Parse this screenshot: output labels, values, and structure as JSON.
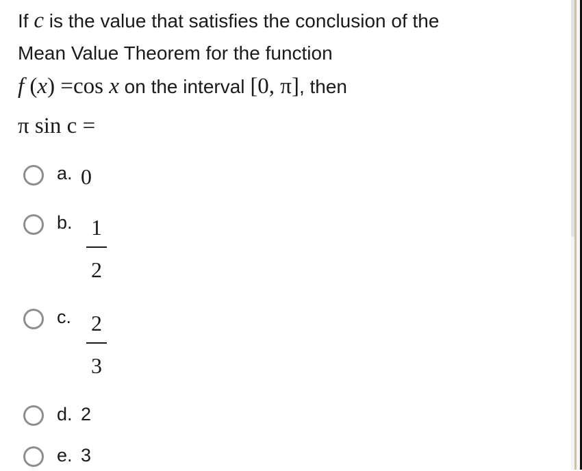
{
  "question": {
    "line1": {
      "prefix": "If ",
      "var": "c",
      "suffix": " is the value that satisfies the conclusion of the"
    },
    "line2": "Mean Value Theorem for the function",
    "line3": {
      "func_name": "f",
      "func_arg_open": " (",
      "func_var": "x",
      "func_arg_close": ") ",
      "equals": "=",
      "cos": "cos ",
      "cos_var": "x",
      "mid_text": " on the interval ",
      "interval": "[0, π]",
      "end_text": ", then"
    },
    "line4": "π sin c  ="
  },
  "options": [
    {
      "letter": "a.",
      "value": "0",
      "type": "plain",
      "selected": false
    },
    {
      "letter": "b.",
      "numerator": "1",
      "denominator": "2",
      "type": "fraction",
      "selected": false
    },
    {
      "letter": "c.",
      "numerator": "2",
      "denominator": "3",
      "type": "fraction",
      "selected": false
    },
    {
      "letter": "d.",
      "value": "2",
      "type": "text",
      "selected": false
    },
    {
      "letter": "e.",
      "value": "3",
      "type": "text",
      "selected": false
    }
  ],
  "colors": {
    "text": "#1a1a1a",
    "radio_border": "#8e8e8e",
    "frame_line": "#c9c2a4"
  }
}
